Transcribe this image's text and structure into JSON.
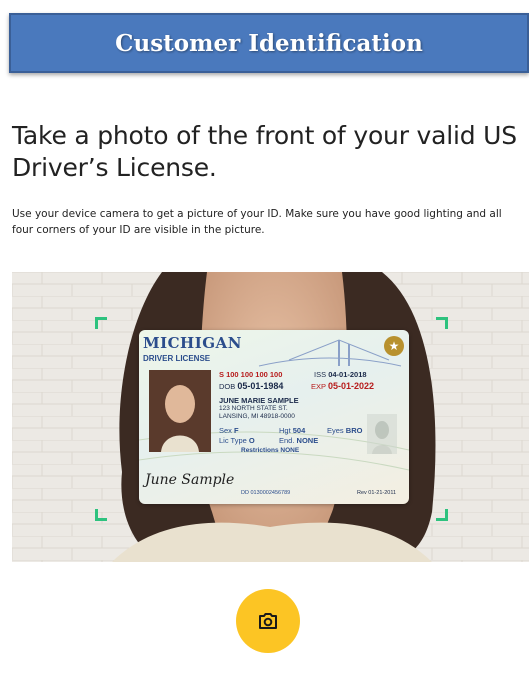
{
  "header": {
    "title": "Customer Identification"
  },
  "main": {
    "heading": "Take a photo of the front of your valid US Driver’s License.",
    "instructions": "Use your device camera to get a picture of your ID. Make sure you have good lighting and all four corners of your ID are visible in the picture."
  },
  "id_card": {
    "state": "MICHIGAN",
    "type": "DRIVER LICENSE",
    "number": "S 100 100 100 100",
    "iss_label": "ISS",
    "iss": "04-01-2018",
    "dob_label": "DOB",
    "dob": "05-01-1984",
    "exp_label": "EXP",
    "exp": "05-01-2022",
    "name": "JUNE MARIE SAMPLE",
    "address1": "123 NORTH STATE ST.",
    "address2": "LANSING, MI 48918-0000",
    "sex_label": "Sex",
    "sex": "F",
    "hgt_label": "Hgt",
    "hgt": "504",
    "eyes_label": "Eyes",
    "eyes": "BRO",
    "lic_type_label": "Lic Type",
    "lic_type": "O",
    "end_label": "End.",
    "end": "NONE",
    "restrictions_label": "Restrictions",
    "restrictions": "NONE",
    "signature": "June Sample",
    "dd": "DD 0130002456789",
    "rev": "Rev 01-21-2011"
  },
  "actions": {
    "camera_icon": "camera-icon"
  },
  "colors": {
    "header_bg": "#4a79bd",
    "corner_marks": "#2ec27e",
    "camera_button": "#fcc524"
  }
}
